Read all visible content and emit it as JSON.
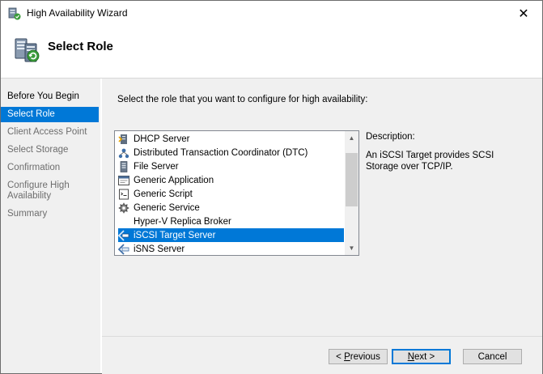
{
  "window": {
    "title": "High Availability Wizard",
    "close_glyph": "✕"
  },
  "header": {
    "title": "Select Role",
    "icon": "wizard-server-icon"
  },
  "nav": {
    "items": [
      {
        "label": "Before You Begin",
        "state": "done"
      },
      {
        "label": "Select Role",
        "state": "active"
      },
      {
        "label": "Client Access Point",
        "state": "pending"
      },
      {
        "label": "Select Storage",
        "state": "pending"
      },
      {
        "label": "Confirmation",
        "state": "pending"
      },
      {
        "label": "Configure High Availability",
        "state": "pending"
      },
      {
        "label": "Summary",
        "state": "pending"
      }
    ]
  },
  "main": {
    "instruction": "Select the role that you want to configure for high availability:",
    "roles": [
      {
        "label": "DHCP Server",
        "icon": "dhcp-icon"
      },
      {
        "label": "Distributed Transaction Coordinator (DTC)",
        "icon": "dtc-icon"
      },
      {
        "label": "File Server",
        "icon": "file-server-icon"
      },
      {
        "label": "Generic Application",
        "icon": "generic-application-icon"
      },
      {
        "label": "Generic Script",
        "icon": "generic-script-icon"
      },
      {
        "label": "Generic Service",
        "icon": "generic-service-icon"
      },
      {
        "label": "Hyper-V Replica Broker",
        "icon": "replica-broker-icon"
      },
      {
        "label": "iSCSI Target Server",
        "icon": "iscsi-icon",
        "selected": true
      },
      {
        "label": "iSNS Server",
        "icon": "isns-icon"
      }
    ],
    "description_label": "Description:",
    "description_text": "An iSCSI Target provides SCSI Storage over TCP/IP."
  },
  "buttons": {
    "previous": {
      "accel": "P",
      "rest": "revious",
      "prefix": "< "
    },
    "next": {
      "accel": "N",
      "rest": "ext >"
    },
    "cancel": "Cancel"
  },
  "colors": {
    "accent": "#0078d7",
    "panel": "#f0f0f0"
  }
}
